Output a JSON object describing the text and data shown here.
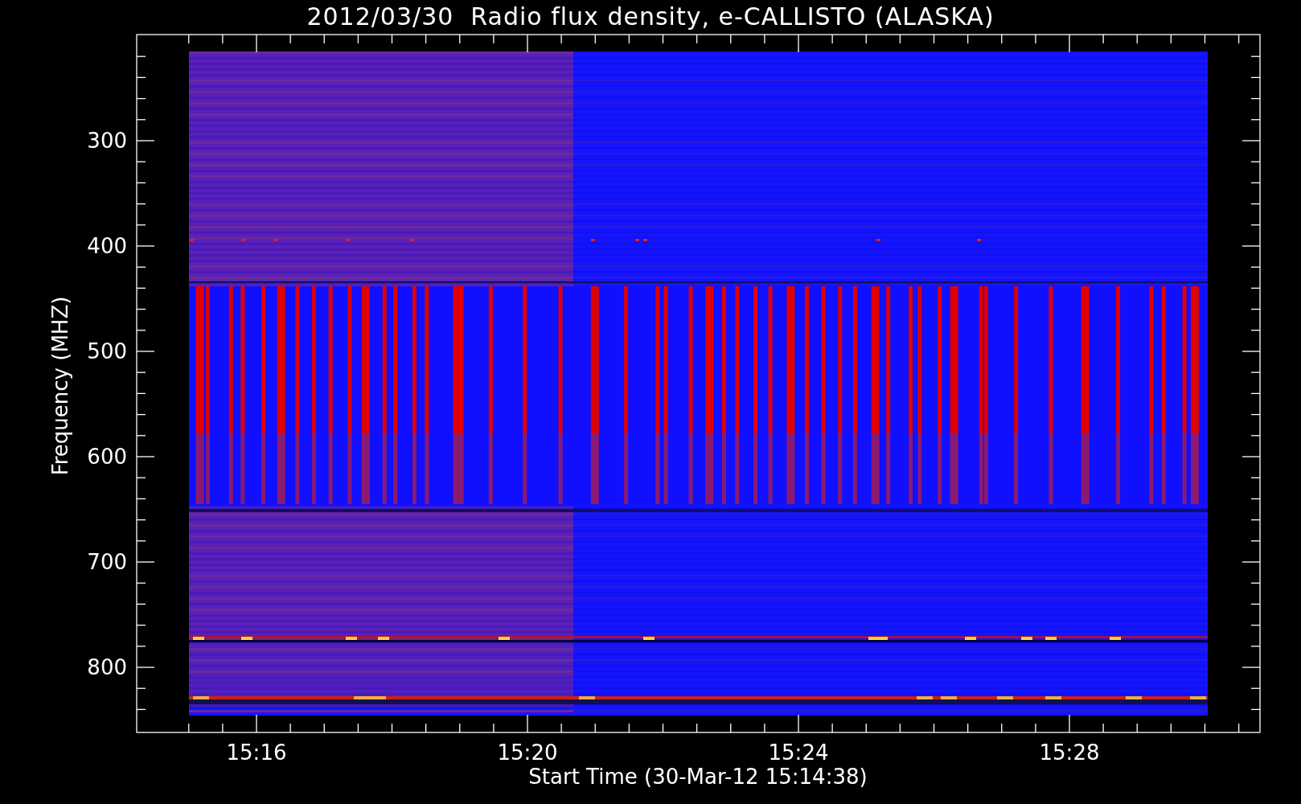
{
  "title": "2012/03/30  Radio flux density, e-CALLISTO (ALASKA)",
  "plot": {
    "ylabel": "Frequency (MHZ)",
    "xlabel": "Start Time (30-Mar-12 15:14:38)",
    "yticks": [
      "300",
      "400",
      "500",
      "600",
      "700",
      "800"
    ],
    "xticks": [
      "15:16",
      "15:20",
      "15:24",
      "15:28"
    ]
  }
}
